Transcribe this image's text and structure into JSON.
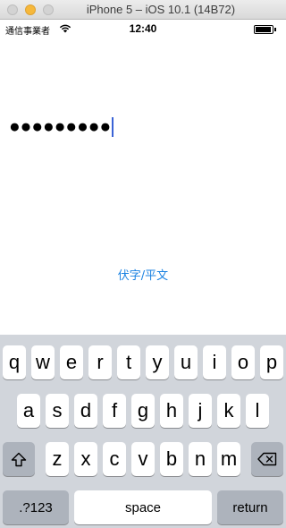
{
  "window": {
    "title": "iPhone 5 – iOS 10.1 (14B72)"
  },
  "status_bar": {
    "carrier": "通信事業者",
    "time": "12:40"
  },
  "password_field": {
    "masked_value": "●●●●●●●●●"
  },
  "toggle_link": {
    "label": "伏字/平文"
  },
  "keyboard": {
    "row1": [
      "q",
      "w",
      "e",
      "r",
      "t",
      "y",
      "u",
      "i",
      "o",
      "p"
    ],
    "row2": [
      "a",
      "s",
      "d",
      "f",
      "g",
      "h",
      "j",
      "k",
      "l"
    ],
    "row3": [
      "z",
      "x",
      "c",
      "v",
      "b",
      "n",
      "m"
    ],
    "numbers_label": ".?123",
    "space_label": "space",
    "return_label": "return"
  }
}
